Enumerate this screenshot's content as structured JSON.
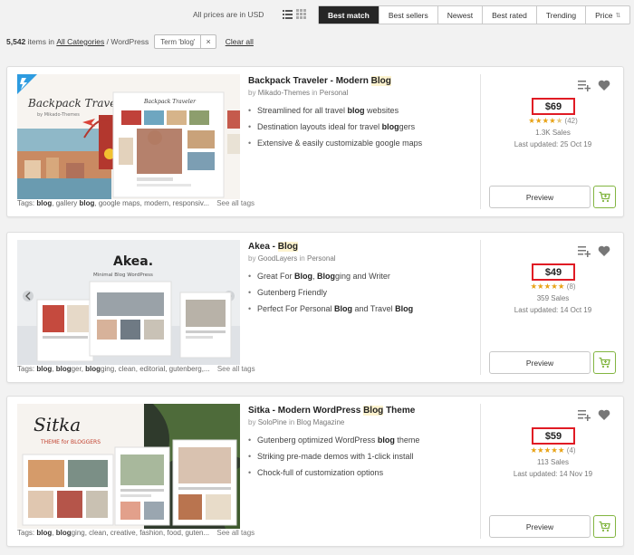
{
  "topbar": {
    "prices_note": "All prices are in USD",
    "sort_options": [
      "Best match",
      "Best sellers",
      "Newest",
      "Best rated",
      "Trending",
      "Price"
    ],
    "active_sort": "Best match",
    "price_arrow": "⇅"
  },
  "filters": {
    "count": "5,542",
    "items_in": "items in",
    "category": "All Categories",
    "separator": "/",
    "subcategory": "WordPress",
    "term_chip": "Term 'blog'",
    "remove": "×",
    "clear_all": "Clear all"
  },
  "colors": {
    "accent_green": "#82b541",
    "price_highlight": "#e01b24",
    "active_sort_bg": "#262626",
    "star": "#e8a317"
  },
  "items": [
    {
      "title_prefix": "Backpack Traveler - Modern ",
      "title_highlight": "Blog",
      "title_suffix": "",
      "by": "by",
      "author": "Mikado-Themes",
      "in": "in",
      "category": "Personal",
      "bullets": [
        {
          "pre": "Streamlined for all travel ",
          "hl": "blog",
          "post": " websites"
        },
        {
          "pre": "Destination layouts ideal for travel ",
          "hl": "blog",
          "post": "gers"
        },
        {
          "pre": "Extensive & easily customizable google maps",
          "hl": "",
          "post": ""
        }
      ],
      "tags_label": "Tags:",
      "tags": [
        {
          "pre": "",
          "hl": "blog",
          "post": ", "
        },
        {
          "pre": "gallery ",
          "hl": "blog",
          "post": ", "
        },
        {
          "pre": "google maps, modern, responsiv...",
          "hl": "",
          "post": ""
        }
      ],
      "see_all": "See all tags",
      "thumb_script": "Backpack Traveler",
      "thumb_sub": "by Mikado-Themes",
      "price": "$69",
      "stars_full": 4,
      "stars_partial": 1,
      "reviews": "(42)",
      "sales": "1.3K Sales",
      "updated": "Last updated: 25 Oct 19",
      "preview": "Preview"
    },
    {
      "title_prefix": "Akea - ",
      "title_highlight": "Blog",
      "title_suffix": "",
      "by": "by",
      "author": "GoodLayers",
      "in": "in",
      "category": "Personal",
      "bullets": [
        {
          "pre": "Great For ",
          "hl": "Blog",
          "post": ", ",
          "hl2": "Blog",
          "post2": "ging and Writer"
        },
        {
          "pre": "Gutenberg Friendly",
          "hl": "",
          "post": ""
        },
        {
          "pre": "Perfect For Personal ",
          "hl": "Blog",
          "post": " and Travel ",
          "hl2": "Blog",
          "post2": ""
        }
      ],
      "tags_label": "Tags:",
      "tags": [
        {
          "pre": "",
          "hl": "blog",
          "post": ", "
        },
        {
          "pre": "",
          "hl": "blog",
          "post": "ger, "
        },
        {
          "pre": "",
          "hl": "blog",
          "post": "ging, clean, editorial, gutenberg,..."
        }
      ],
      "see_all": "See all tags",
      "thumb_logo": "Akea.",
      "thumb_sub": "Minimal Blog WordPress",
      "price": "$49",
      "stars_full": 5,
      "stars_partial": 0,
      "reviews": "(8)",
      "sales": "359 Sales",
      "updated": "Last updated: 14 Oct 19",
      "preview": "Preview"
    },
    {
      "title_prefix": "Sitka - Modern WordPress ",
      "title_highlight": "Blog",
      "title_suffix": " Theme",
      "by": "by",
      "author": "SoloPine",
      "in": "in",
      "category": "Blog Magazine",
      "bullets": [
        {
          "pre": "Gutenberg optimized WordPress ",
          "hl": "blog",
          "post": " theme"
        },
        {
          "pre": "Striking pre-made demos with 1-click install",
          "hl": "",
          "post": ""
        },
        {
          "pre": "Chock-full of customization options",
          "hl": "",
          "post": ""
        }
      ],
      "tags_label": "Tags:",
      "tags": [
        {
          "pre": "",
          "hl": "blog",
          "post": ", "
        },
        {
          "pre": "",
          "hl": "blog",
          "post": "ging, clean, creative, fashion, food, guten..."
        }
      ],
      "see_all": "See all tags",
      "thumb_script": "Sitka",
      "thumb_sub": "THEME for BLOGGERS",
      "price": "$59",
      "stars_full": 5,
      "stars_partial": 0,
      "reviews": "(4)",
      "sales": "113 Sales",
      "updated": "Last updated: 14 Nov 19",
      "preview": "Preview"
    }
  ]
}
